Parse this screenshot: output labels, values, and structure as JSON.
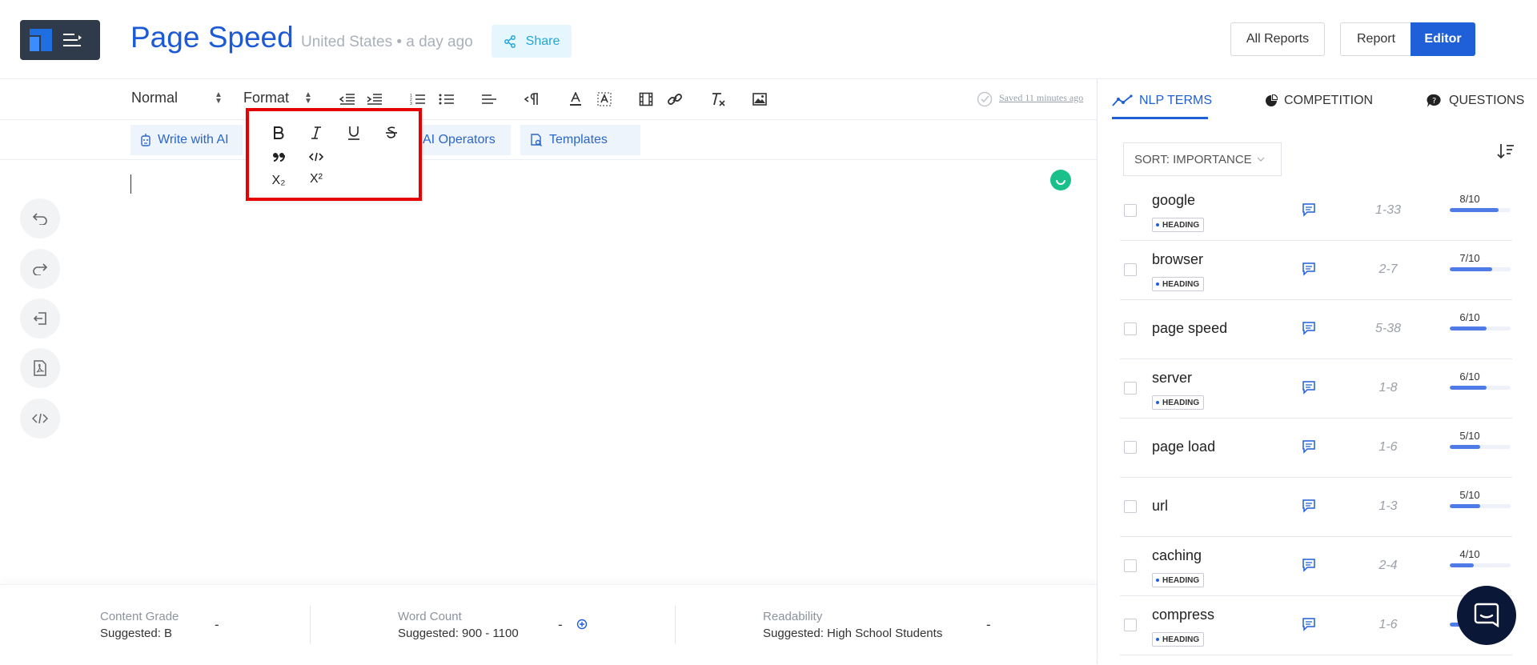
{
  "header": {
    "title": "Page Speed",
    "subtitle": "United States • a day ago",
    "share_label": "Share",
    "all_reports_label": "All Reports",
    "report_label": "Report",
    "editor_label": "Editor"
  },
  "toolbar": {
    "style_select": "Normal",
    "format_select": "Format",
    "saved_text": "Saved 11 minutes ago"
  },
  "ai_bar": {
    "write_with_ai": "Write with AI",
    "ai_operators": "AI Operators",
    "templates": "Templates"
  },
  "format_popup": {
    "subscript_label": "X₂",
    "superscript_label": "X²"
  },
  "footer": {
    "content_grade": {
      "label": "Content Grade",
      "suggested": "Suggested: B",
      "value": "-"
    },
    "word_count": {
      "label": "Word Count",
      "suggested": "Suggested: 900 - 1100",
      "value": "-"
    },
    "readability": {
      "label": "Readability",
      "suggested": "Suggested: High School Students",
      "value": "-"
    }
  },
  "panel": {
    "tabs": [
      {
        "label": "NLP TERMS"
      },
      {
        "label": "COMPETITION"
      },
      {
        "label": "QUESTIONS"
      }
    ],
    "sort_label": "SORT: IMPORTANCE",
    "heading_badge": "HEADING",
    "terms": [
      {
        "name": "google",
        "heading": true,
        "range": "1-33",
        "score": "8/10",
        "fraction": 0.8
      },
      {
        "name": "browser",
        "heading": true,
        "range": "2-7",
        "score": "7/10",
        "fraction": 0.7
      },
      {
        "name": "page speed",
        "heading": false,
        "range": "5-38",
        "score": "6/10",
        "fraction": 0.6
      },
      {
        "name": "server",
        "heading": true,
        "range": "1-8",
        "score": "6/10",
        "fraction": 0.6
      },
      {
        "name": "page load",
        "heading": false,
        "range": "1-6",
        "score": "5/10",
        "fraction": 0.5
      },
      {
        "name": "url",
        "heading": false,
        "range": "1-3",
        "score": "5/10",
        "fraction": 0.5
      },
      {
        "name": "caching",
        "heading": true,
        "range": "2-4",
        "score": "4/10",
        "fraction": 0.4
      },
      {
        "name": "compress",
        "heading": true,
        "range": "1-6",
        "score": "",
        "fraction": 0.4
      }
    ]
  },
  "colors": {
    "accent": "#1f5fd8",
    "share": "#22a6d8",
    "highlight": "#e60000"
  }
}
